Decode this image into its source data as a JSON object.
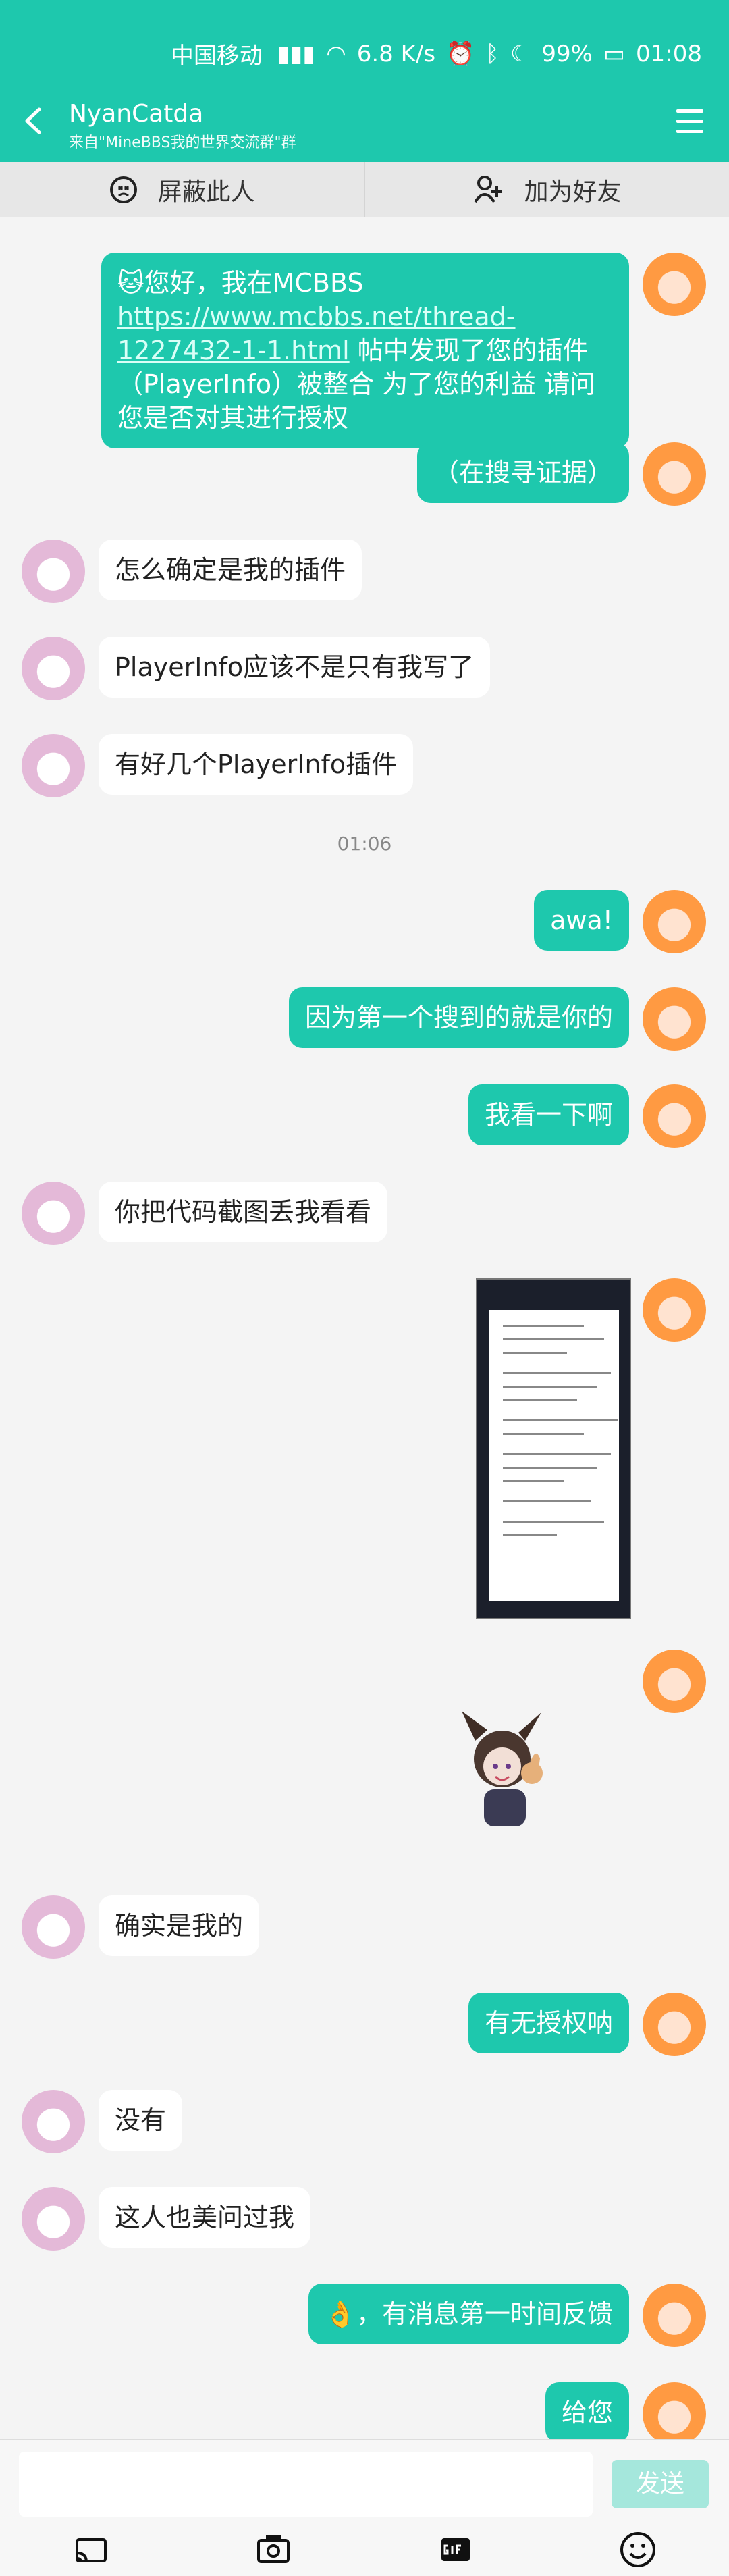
{
  "status_bar": {
    "carrier": "中国移动",
    "net_speed": "6.8 K/s",
    "battery": "99%",
    "time": "01:08"
  },
  "header": {
    "title": "NyanCatda",
    "subtitle": "来自\"MineBBS我的世界交流群\"群"
  },
  "actions": {
    "block": "屏蔽此人",
    "add_friend": "加为好友"
  },
  "messages": [
    {
      "from": "me",
      "text_before_link": "🐱您好，我在MCBBS ",
      "link": "https://www.mcbbs.net/thread-1227432-1-1.html",
      "text_after_link": " 帖中发现了您的插件（PlayerInfo）被整合 为了您的利益 请问您是否对其进行授权"
    },
    {
      "from": "me",
      "text": "（在搜寻证据）"
    },
    {
      "from": "other",
      "text": "怎么确定是我的插件"
    },
    {
      "from": "other",
      "text": "PlayerInfo应该不是只有我写了"
    },
    {
      "from": "other",
      "text": "有好几个PlayerInfo插件"
    },
    {
      "from": "me",
      "text": "awa!"
    },
    {
      "from": "me",
      "text": "因为第一个搜到的就是你的"
    },
    {
      "from": "me",
      "text": "我看一下啊"
    },
    {
      "from": "other",
      "text": "你把代码截图丢我看看"
    },
    {
      "from": "other",
      "text": "确实是我的"
    },
    {
      "from": "me",
      "text": "有无授权呐"
    },
    {
      "from": "other",
      "text": "没有"
    },
    {
      "from": "other",
      "text": "这人也美问过我"
    },
    {
      "from": "me",
      "text": "👌，有消息第一时间反馈"
    },
    {
      "from": "me",
      "text": "给您"
    }
  ],
  "timestamp": "01:06",
  "input": {
    "placeholder": "",
    "send_label": "发送"
  },
  "toolbar_icons": [
    "cast-icon",
    "camera-icon",
    "gif-icon",
    "emoji-icon"
  ]
}
